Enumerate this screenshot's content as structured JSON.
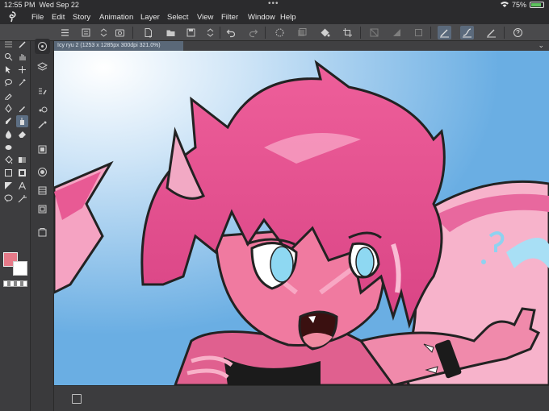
{
  "status_bar": {
    "time": "12:55 PM",
    "date": "Wed Sep 22",
    "battery": "75%",
    "battery_level": 0.75
  },
  "menu": {
    "items": [
      "File",
      "Edit",
      "Story",
      "Animation",
      "Layer",
      "Select",
      "View",
      "Filter",
      "Window",
      "Help"
    ]
  },
  "document_tab": {
    "title": "Icy ryu 2 (1253 x 1285px 300dpi 321.0%)"
  },
  "colors": {
    "main_color": "#e67a89",
    "sub_color": "#ffffff",
    "accent": "#5b6a7c"
  },
  "toolbar_icons": [
    "menu-icon",
    "layer-stack-icon",
    "updown-icon",
    "camera-icon",
    "new-doc-icon",
    "open-folder-icon",
    "save-icon",
    "updown-icon",
    "undo-icon",
    "redo-icon",
    "loading-icon",
    "layer-icon",
    "fill-icon",
    "crop-icon",
    "transform-icon",
    "gradient-icon",
    "frame-icon",
    "brush-line-icon",
    "brush-curve-icon",
    "brush-pressure-icon",
    "help-icon"
  ]
}
